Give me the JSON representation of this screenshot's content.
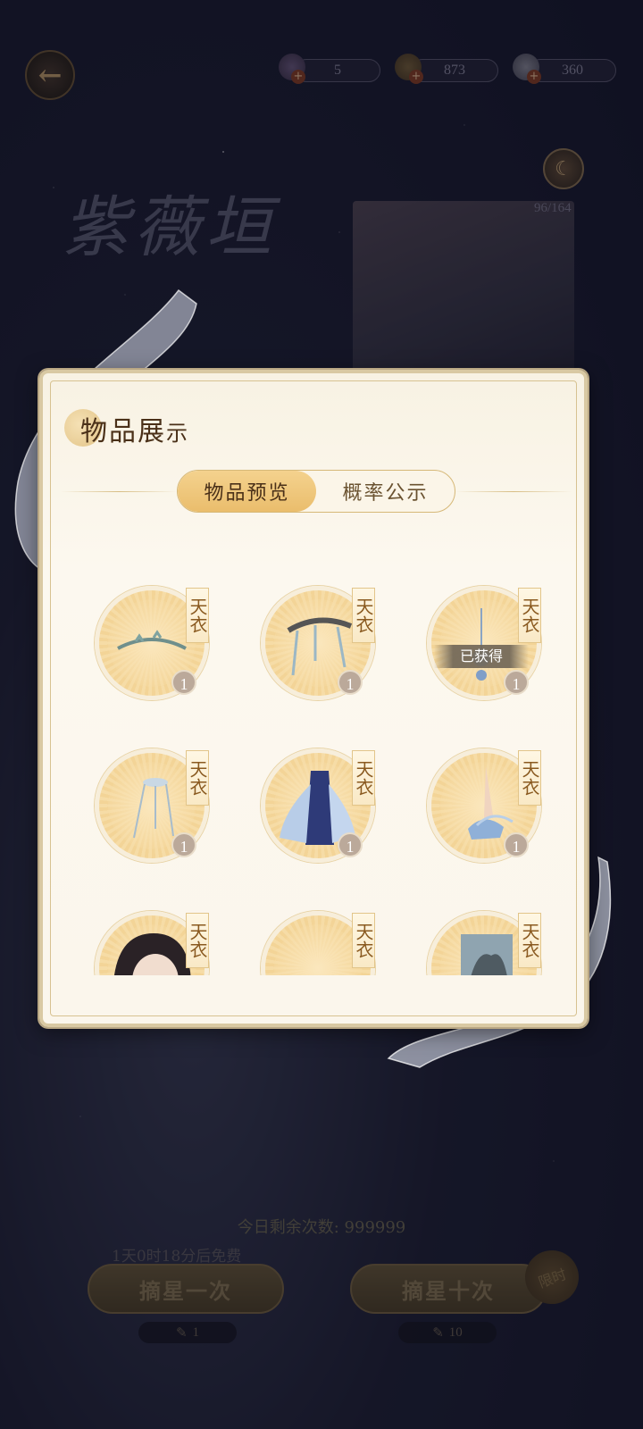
{
  "top_bar": {
    "back_icon": "arrow-left-icon",
    "currencies": [
      {
        "icon": "key-figure-icon",
        "value": "5"
      },
      {
        "icon": "gold-ingot-icon",
        "value": "873"
      },
      {
        "icon": "pearl-icon",
        "value": "360"
      }
    ],
    "plus_label": "+"
  },
  "banner": {
    "title": "紫薇垣",
    "progress": "96/164",
    "moon_icon": "crescent-moon-icon"
  },
  "modal": {
    "title_main": "物品展",
    "title_tail": "示",
    "tabs": [
      {
        "label": "物品预览",
        "active": true
      },
      {
        "label": "概率公示",
        "active": false
      }
    ],
    "items": [
      {
        "name": "item-hairband",
        "tag": "天衣",
        "count": "1",
        "obtained": false,
        "icon": "hairband-icon"
      },
      {
        "name": "item-headpiece",
        "tag": "天衣",
        "count": "1",
        "obtained": false,
        "icon": "headpiece-icon"
      },
      {
        "name": "item-earring",
        "tag": "天衣",
        "count": "1",
        "obtained": true,
        "obtained_label": "已获得",
        "icon": "earring-icon"
      },
      {
        "name": "item-hairpin",
        "tag": "天衣",
        "count": "1",
        "obtained": false,
        "icon": "hairpin-icon"
      },
      {
        "name": "item-dress",
        "tag": "天衣",
        "count": "1",
        "obtained": false,
        "icon": "dress-icon"
      },
      {
        "name": "item-shoes",
        "tag": "天衣",
        "count": "1",
        "obtained": false,
        "icon": "shoes-icon"
      },
      {
        "name": "item-portrait",
        "tag": "天衣",
        "icon": "portrait-icon"
      },
      {
        "name": "item-unknown",
        "tag": "天衣",
        "icon": "item-icon"
      },
      {
        "name": "item-card",
        "tag": "天衣",
        "icon": "card-icon"
      }
    ]
  },
  "bottom": {
    "remaining": "今日剩余次数: 999999",
    "free_timer": "1天0时18分后免费",
    "draw_one": "摘星一次",
    "draw_ten": "摘星十次",
    "cost_one": "1",
    "cost_ten": "10",
    "limited_badge": "限时"
  }
}
